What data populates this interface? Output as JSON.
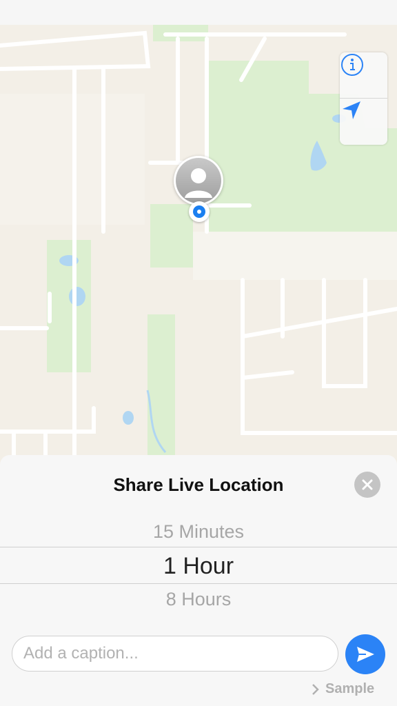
{
  "map": {
    "controls": {
      "info_icon": "info-circle-icon",
      "location_icon": "location-arrow-icon"
    },
    "colors": {
      "land": "#f3efe7",
      "park": "#dcefd0",
      "water": "#b0d6f2",
      "road": "#ffffff",
      "user_dot": "#1b7ff0"
    }
  },
  "sheet": {
    "title": "Share Live Location",
    "close_icon": "close-icon",
    "duration_options": {
      "previous": "15 Minutes",
      "selected": "1 Hour",
      "next": "8 Hours"
    },
    "caption": {
      "placeholder": "Add a caption...",
      "value": ""
    },
    "send_icon": "send-icon",
    "sample_label": "Sample",
    "accent_color": "#2b83f6"
  }
}
